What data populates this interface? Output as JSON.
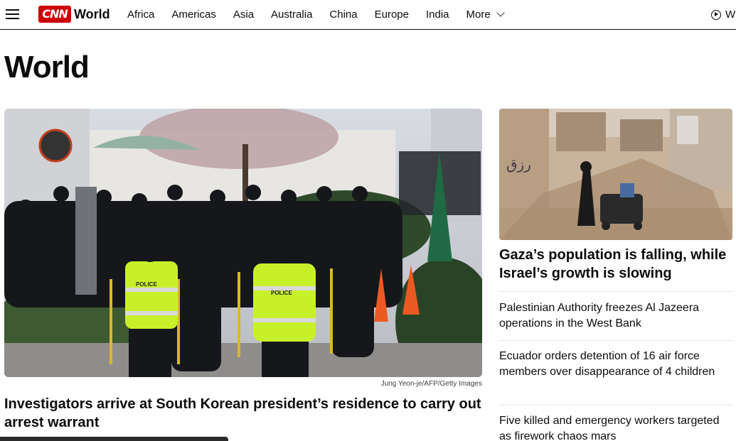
{
  "header": {
    "logo": "CNN",
    "section": "World",
    "nav": [
      "Africa",
      "Americas",
      "Asia",
      "Australia",
      "China",
      "Europe",
      "India"
    ],
    "more_label": "More",
    "watch_label": "W"
  },
  "page_title": "World",
  "lead": {
    "credit": "Jung Yeon-je/AFP/Getty Images",
    "headline": "Investigators arrive at South Korean president’s residence to carry out arrest warrant",
    "police_text": "POLICE"
  },
  "side": {
    "headline": "Gaza’s population is falling, while Israel’s growth is slowing",
    "items": [
      "Palestinian Authority freezes Al Jazeera operations in the West Bank",
      "Ecuador orders detention of 16 air force members over disappearance of 4 children",
      "Five killed and emergency workers targeted as firework chaos mars"
    ]
  },
  "colors": {
    "brand": "#cc0000",
    "police_vest": "#c8f02a"
  }
}
